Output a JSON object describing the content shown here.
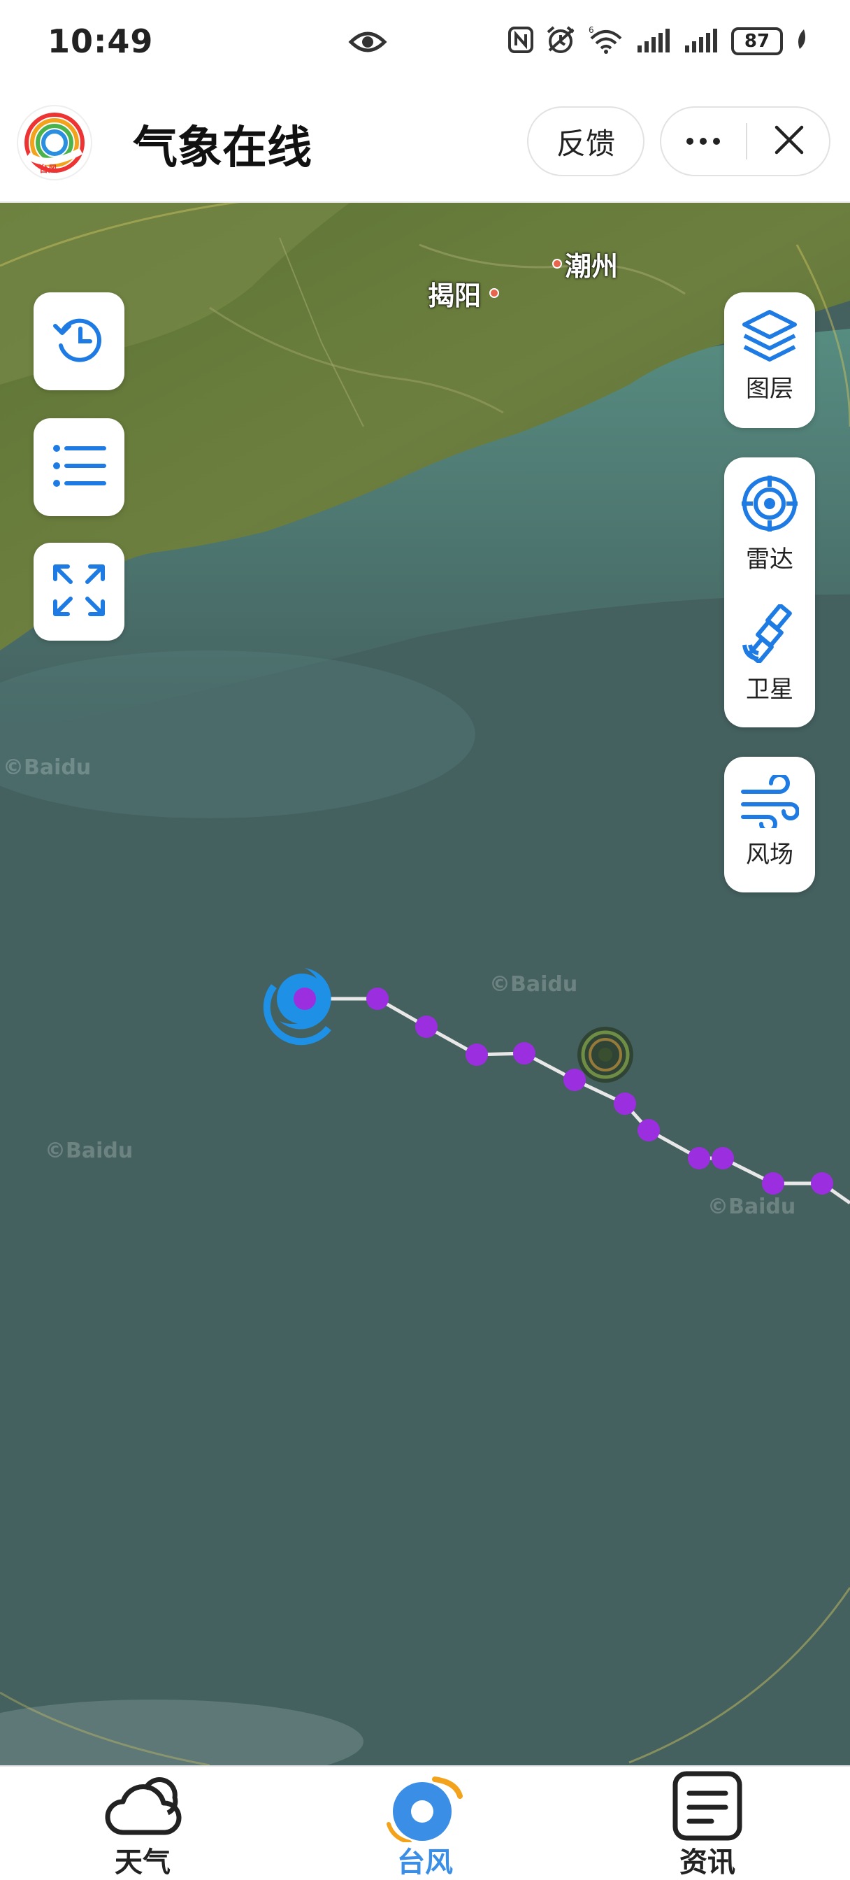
{
  "status_bar": {
    "time": "10:49",
    "battery": "87",
    "icons": [
      "eye-icon",
      "nfc-icon",
      "alarm-icon",
      "wifi-6-icon",
      "signal-icon",
      "signal-icon",
      "battery-icon",
      "leaf-icon"
    ]
  },
  "header": {
    "title": "气象在线",
    "logo_text": "台风",
    "feedback_label": "反馈",
    "more_icon": "more-icon",
    "close_icon": "close-icon"
  },
  "map": {
    "cities": [
      {
        "name": "潮州"
      },
      {
        "name": "揭阳"
      }
    ],
    "watermark": "©Baidu",
    "left_controls": [
      "history-icon",
      "list-icon",
      "fullscreen-icon"
    ],
    "right_controls": {
      "layers_label": "图层",
      "radar_label": "雷达",
      "satellite_label": "卫星",
      "wind_label": "风场"
    },
    "accent_color": "#1e7be3",
    "track_point_color": "#9b2fe0",
    "current_position_color": "#1e90e6"
  },
  "tabs": [
    {
      "label": "天气",
      "icon": "cloud-icon",
      "active": false
    },
    {
      "label": "台风",
      "icon": "typhoon-icon",
      "active": true
    },
    {
      "label": "资讯",
      "icon": "news-icon",
      "active": false
    }
  ],
  "active_tab_color": "#3a8ee6"
}
